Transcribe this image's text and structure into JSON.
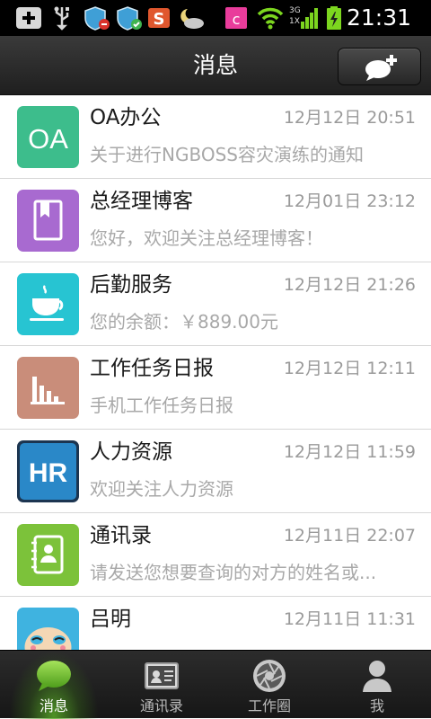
{
  "status_bar": {
    "time": "21:31",
    "signal_label": "3G 1X",
    "icons": [
      "add-icon",
      "usb-icon",
      "shield-icon",
      "shield-icon",
      "s-app-icon",
      "weather-icon",
      "c-app-icon",
      "wifi-icon",
      "signal-icon",
      "battery-icon"
    ]
  },
  "header": {
    "title": "消息",
    "compose_icon": "new-chat-icon"
  },
  "conversations": [
    {
      "title": "OA办公",
      "time": "12月12日 20:51",
      "preview": "关于进行NGBOSS容灾演练的通知",
      "avatar_text": "OA",
      "avatar_color": "#3dbd8c"
    },
    {
      "title": "总经理博客",
      "time": "12月01日 23:12",
      "preview": "您好，欢迎关注总经理博客！",
      "avatar_icon": "book-icon",
      "avatar_color": "#a86ad0"
    },
    {
      "title": "后勤服务",
      "time": "12月12日 21:26",
      "preview": "您的余额：￥889.00元",
      "avatar_icon": "coffee-cup-icon",
      "avatar_color": "#27c4d2"
    },
    {
      "title": "工作任务日报",
      "time": "12月12日 12:11",
      "preview": "手机工作任务日报",
      "avatar_icon": "bar-chart-icon",
      "avatar_color": "#c98d7a"
    },
    {
      "title": "人力资源",
      "time": "12月12日 11:59",
      "preview": "欢迎关注人力资源",
      "avatar_text": "HR",
      "avatar_color": "#2a88c8"
    },
    {
      "title": "通讯录",
      "time": "12月11日 22:07",
      "preview": "请发送您想要查询的对方的姓名或...",
      "avatar_icon": "address-book-icon",
      "avatar_color": "#7cc23a"
    },
    {
      "title": "吕明",
      "time": "12月11日 11:31",
      "preview": "",
      "avatar_icon": "cartoon-monkey-avatar",
      "avatar_color": "#3fb3e0"
    }
  ],
  "tabs": [
    {
      "label": "消息",
      "icon": "chat-bubble-icon",
      "active": true
    },
    {
      "label": "通讯录",
      "icon": "contact-card-icon",
      "active": false
    },
    {
      "label": "工作圈",
      "icon": "aperture-icon",
      "active": false
    },
    {
      "label": "我",
      "icon": "person-icon",
      "active": false
    }
  ]
}
